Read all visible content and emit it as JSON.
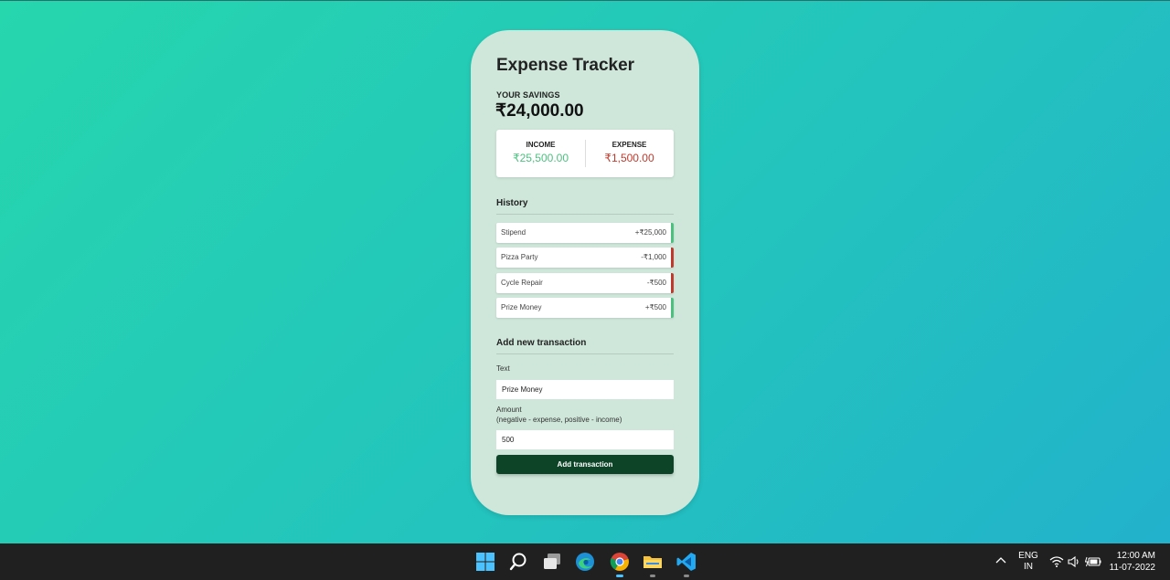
{
  "app": {
    "title": "Expense Tracker",
    "savings_label": "YOUR SAVINGS",
    "savings_value": "₹24,000.00",
    "income_label": "INCOME",
    "income_value": "₹25,500.00",
    "expense_label": "EXPENSE",
    "expense_value": "₹1,500.00"
  },
  "history": {
    "title": "History",
    "items": [
      {
        "text": "Stipend",
        "amount": "+₹25,000",
        "type": "plus"
      },
      {
        "text": "Pizza Party",
        "amount": "-₹1,000",
        "type": "minus"
      },
      {
        "text": "Cycle Repair",
        "amount": "-₹500",
        "type": "minus"
      },
      {
        "text": "Prize Money",
        "amount": "+₹500",
        "type": "plus"
      }
    ]
  },
  "form": {
    "title": "Add new transaction",
    "text_label": "Text",
    "text_value": "Prize Money",
    "amount_label": "Amount",
    "amount_hint": "(negative - expense, positive - income)",
    "amount_value": "500",
    "submit_label": "Add transaction"
  },
  "taskbar": {
    "icons": [
      "windows-start-icon",
      "search-icon",
      "task-view-icon",
      "edge-browser-icon",
      "chrome-browser-icon",
      "file-explorer-icon",
      "vscode-icon"
    ],
    "lang_top": "ENG",
    "lang_bottom": "IN",
    "time": "12:00 AM",
    "date": "11-07-2022"
  },
  "colors": {
    "income": "#4cc17f",
    "expense": "#c0392b",
    "button": "#0d4428",
    "card": "#cfe7da"
  }
}
